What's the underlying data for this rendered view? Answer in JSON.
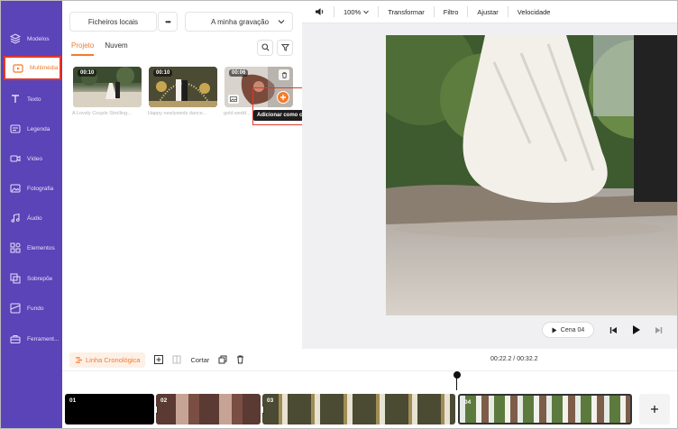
{
  "sidebar": {
    "items": [
      {
        "label": "Modelos",
        "icon": "templates-icon"
      },
      {
        "label": "Multimédia",
        "icon": "media-icon",
        "active": true
      },
      {
        "label": "Texto",
        "icon": "text-icon"
      },
      {
        "label": "Legenda",
        "icon": "caption-icon"
      },
      {
        "label": "Vídeo",
        "icon": "video-icon"
      },
      {
        "label": "Fotografia",
        "icon": "photo-icon"
      },
      {
        "label": "Áudio",
        "icon": "audio-icon"
      },
      {
        "label": "Elementos",
        "icon": "elements-icon"
      },
      {
        "label": "Sobrepõe",
        "icon": "overlay-icon"
      },
      {
        "label": "Fundo",
        "icon": "background-icon"
      },
      {
        "label": "Ferrament...",
        "icon": "tools-icon"
      }
    ]
  },
  "panel": {
    "local_files": "Ficheiros locais",
    "more": "•••",
    "recording": "A minha gravação",
    "tabs": [
      "Projeto",
      "Nuvem"
    ],
    "media": [
      {
        "duration": "00:10",
        "caption": "A Lovely Couple Strolling..."
      },
      {
        "duration": "00:10",
        "caption": "Happy newlyweds dance..."
      },
      {
        "duration": "00:06",
        "caption": "gold wedd..."
      }
    ],
    "tooltip": "Adicionar como cena"
  },
  "toolbar": {
    "zoom": "100%",
    "items": [
      "Transformar",
      "Filtro",
      "Ajustar",
      "Velocidade"
    ]
  },
  "player": {
    "scene_label": "Cena 04"
  },
  "timeline": {
    "label": "Linha Cronológica",
    "cut": "Cortar",
    "time": "00:22.2 / 00:32.2",
    "clips": [
      "01",
      "02",
      "03",
      "04"
    ]
  },
  "colors": {
    "sidebar": "#5b43b8",
    "accent": "#f47a29",
    "highlight": "#e0392b"
  }
}
